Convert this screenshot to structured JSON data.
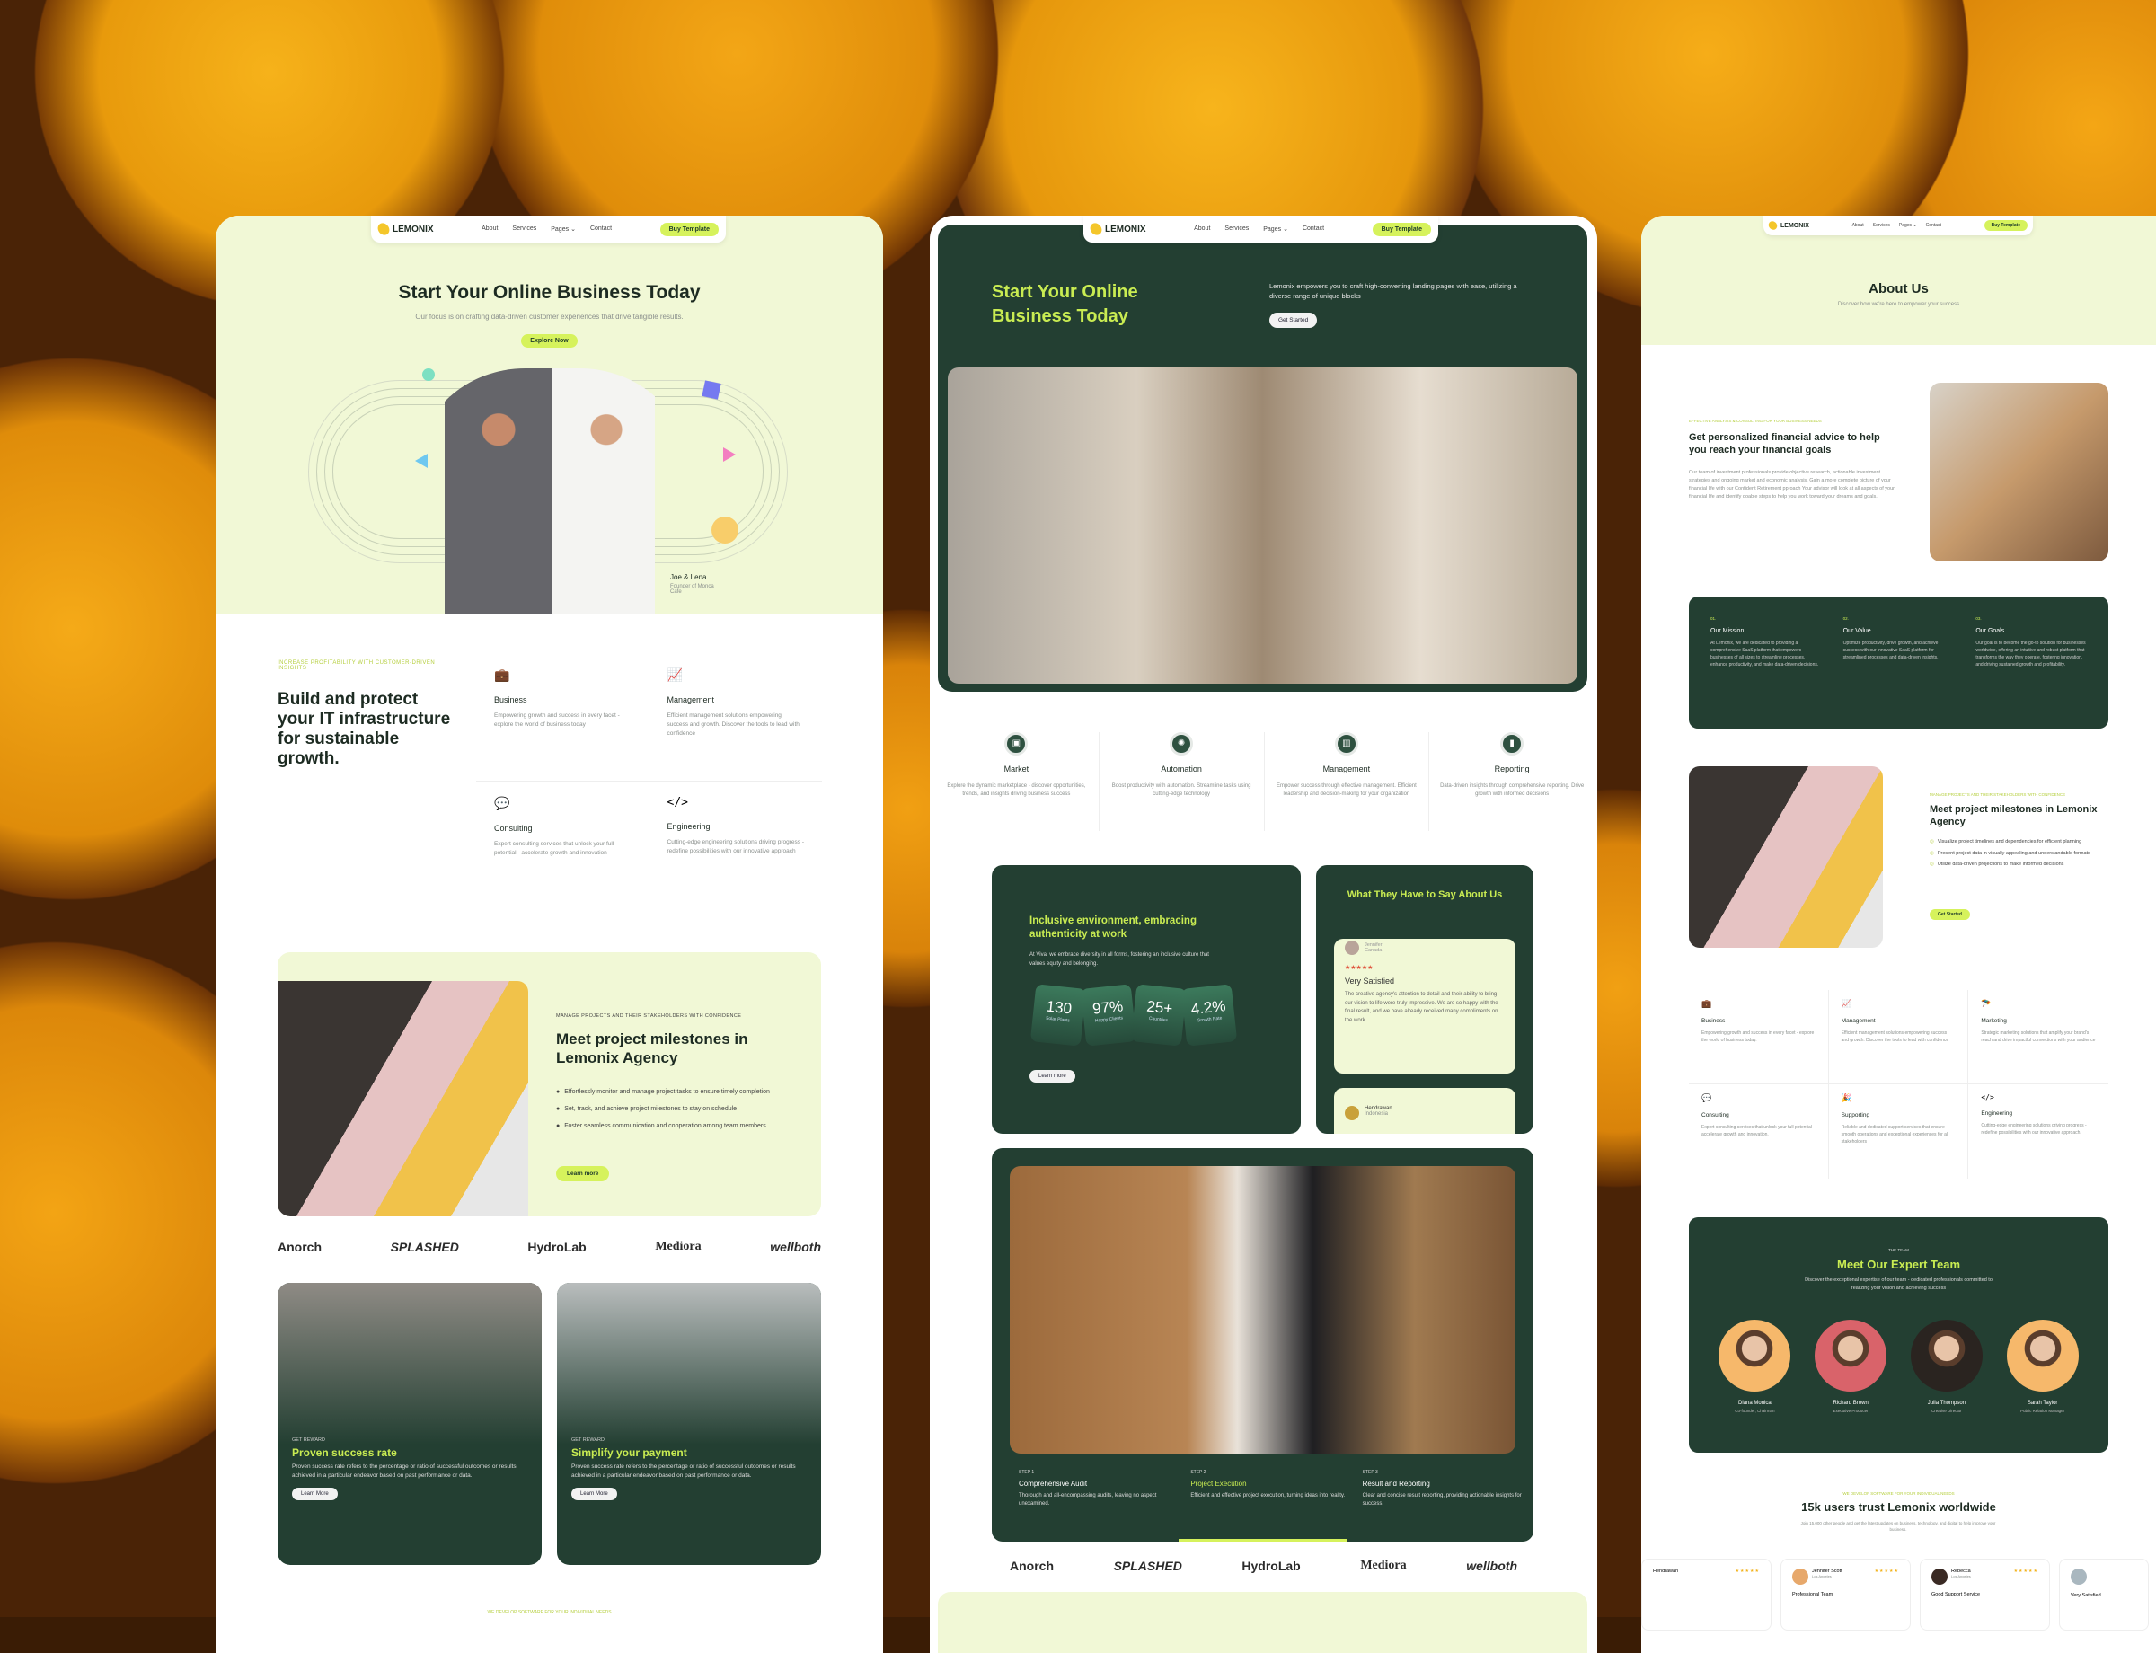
{
  "brand": "LEMONIX",
  "nav": {
    "items": [
      "About",
      "Services",
      "Pages",
      "Contact"
    ],
    "cta": "Buy Template"
  },
  "colors": {
    "accent_lime": "#d6f25c",
    "dark_green": "#233f32",
    "light_bg": "#f1f8d6",
    "text_dark": "#1d2b22"
  },
  "home1": {
    "hero": {
      "title": "Start Your Online Business Today",
      "subtitle": "Our focus is on crafting data-driven customer experiences that drive tangible results.",
      "cta": "Explore Now",
      "caption_name": "Joe & Lena",
      "caption_role": "Founder of Monca Cafe"
    },
    "services": {
      "eyebrow": "INCREASE PROFITABILITY WITH CUSTOMER-DRIVEN INSIGHTS",
      "title": "Build and protect your IT infrastructure for sustainable growth.",
      "items": [
        {
          "icon": "briefcase-icon",
          "title": "Business",
          "desc": "Empowering growth and success in every facet - explore the world of business today"
        },
        {
          "icon": "chart-line-icon",
          "title": "Management",
          "desc": "Efficient management solutions empowering success and growth. Discover the tools to lead with confidence"
        },
        {
          "icon": "chat-icon",
          "title": "Consulting",
          "desc": "Expert consulting services that unlock your full potential - accelerate growth and innovation"
        },
        {
          "icon": "code-icon",
          "title": "Engineering",
          "desc": "Cutting-edge engineering solutions driving progress - redefine possibilities with our innovative approach"
        }
      ]
    },
    "milestones": {
      "eyebrow": "MANAGE PROJECTS AND THEIR STAKEHOLDERS WITH CONFIDENCE",
      "title": "Meet project milestones in Lemonix Agency",
      "bullets": [
        "Effortlessly monitor and manage project tasks to ensure timely completion",
        "Set, track, and achieve project milestones to stay on schedule",
        "Foster seamless communication and cooperation among team members"
      ],
      "cta": "Learn more"
    },
    "logos": [
      "Anorch",
      "SPLASHED",
      "HydroLab",
      "Mediora",
      "wellboth"
    ],
    "rewards": [
      {
        "eyebrow": "GET REWARD",
        "title": "Proven success rate",
        "desc": "Proven success rate refers to the percentage or ratio of successful outcomes or results achieved in a particular endeavor based on past performance or data.",
        "cta": "Learn More"
      },
      {
        "eyebrow": "GET REWARD",
        "title": "Simplify your payment",
        "desc": "Proven success rate refers to the percentage or ratio of successful outcomes or results achieved in a particular endeavor based on past performance or data.",
        "cta": "Learn More"
      }
    ],
    "footer_eyebrow": "WE DEVELOP SOFTWARE FOR YOUR INDIVIDUAL NEEDS"
  },
  "home2": {
    "hero": {
      "title": "Start Your Online Business Today",
      "desc": "Lemonix empowers you to craft high-converting landing pages with ease, utilizing a diverse range of unique blocks",
      "cta": "Get Started"
    },
    "features": [
      {
        "icon": "briefcase-icon",
        "title": "Market",
        "desc": "Explore the dynamic marketplace - discover opportunities, trends, and insights driving business success"
      },
      {
        "icon": "brain-icon",
        "title": "Automation",
        "desc": "Boost productivity with automation. Streamline tasks using cutting-edge technology"
      },
      {
        "icon": "books-icon",
        "title": "Management",
        "desc": "Empower success through effective management. Efficient leadership and decision-making for your organization"
      },
      {
        "icon": "bar-chart-icon",
        "title": "Reporting",
        "desc": "Data-driven insights through comprehensive reporting. Drive growth with informed decisions"
      }
    ],
    "culture": {
      "title": "Inclusive environment, embracing authenticity at work",
      "desc": "At Viva, we embrace diversity in all forms, fostering an inclusive culture that values equity and belonging.",
      "stats": [
        {
          "value": "130",
          "label": "Solar Plants"
        },
        {
          "value": "97%",
          "label": "Happy Clients"
        },
        {
          "value": "25+",
          "label": "Countries"
        },
        {
          "value": "4.2%",
          "label": "Growth Rate"
        }
      ],
      "cta": "Learn more"
    },
    "testimonials": {
      "title": "What They Have to Say About Us",
      "items": [
        {
          "name": "Jennifer",
          "location": "Canada",
          "rating": 5,
          "title": "Very Satisfied",
          "text": "The creative agency's attention to detail and their ability to bring our vision to life were truly impressive. We are so happy with the final result, and we have already received many compliments on the work."
        },
        {
          "name": "Hendrawan",
          "location": "Indonesia"
        }
      ]
    },
    "steps": [
      {
        "label": "STEP 1",
        "title": "Comprehensive Audit",
        "desc": "Thorough and all-encompassing audits, leaving no aspect unexamined."
      },
      {
        "label": "STEP 2",
        "title": "Project Execution",
        "desc": "Efficient and effective project execution, turning ideas into reality."
      },
      {
        "label": "STEP 3",
        "title": "Result and Reporting",
        "desc": "Clear and concise result reporting, providing actionable insights for success."
      }
    ],
    "active_step": 2
  },
  "about": {
    "hero": {
      "title": "About Us",
      "subtitle": "Discover how we're here to empower your success"
    },
    "intro": {
      "eyebrow": "EFFECTIVE ANALYSIS & CONSULTING FOR YOUR BUSINESS NEEDS",
      "title": "Get personalized financial advice to help you reach your financial goals",
      "body": "Our team of investment professionals provide objective research, actionable investment strategies and ongoing market and economic analysis. Gain a more complete picture of your financial life with our Confident Retirement pproach Your advisor will look at all aspects of your financial life and identify doable steps to help you work toward your dreams and goals."
    },
    "values": [
      {
        "num": "01.",
        "title": "Our Mission",
        "desc": "At Lemonix, we are dedicated to providing a comprehensive SaaS platform that empowers businesses of all sizes to streamline processes, enhance productivity, and make data-driven decisions."
      },
      {
        "num": "02.",
        "title": "Our Value",
        "desc": "Optimize productivity, drive growth, and achieve success with our innovative SaaS platform for streamlined processes and data-driven insights."
      },
      {
        "num": "03.",
        "title": "Our Goals",
        "desc": "Our goal is to become the go-to solution for businesses worldwide, offering an intuitive and robust platform that transforms the way they operate, fostering innovation, and driving sustained growth and profitability."
      }
    ],
    "milestones": {
      "eyebrow": "MANAGE PROJECTS AND THEIR STAKEHOLDERS WITH CONFIDENCE",
      "title": "Meet project milestones in Lemonix Agency",
      "bullets": [
        "Visualize project timelines and dependencies for efficient planning",
        "Present project data in visually appealing and understandable formats",
        "Utilize data-driven projections to make informed decisions"
      ],
      "cta": "Get Started"
    },
    "services": [
      {
        "icon": "briefcase-icon",
        "title": "Business",
        "desc": "Empowering growth and success in every facet - explore the world of business today."
      },
      {
        "icon": "chart-line-icon",
        "title": "Management",
        "desc": "Efficient management solutions empowering success and growth. Discover the tools to lead with confidence"
      },
      {
        "icon": "parachute-icon",
        "title": "Marketing",
        "desc": "Strategic marketing solutions that amplify your brand's reach and drive impactful connections with your audience"
      },
      {
        "icon": "chat-icon",
        "title": "Consulting",
        "desc": "Expert consulting services that unlock your full potential - accelerate growth and innovation."
      },
      {
        "icon": "party-icon",
        "title": "Supporting",
        "desc": "Reliable and dedicated support services that ensure smooth operations and exceptional experiences for all stakeholders"
      },
      {
        "icon": "code-icon",
        "title": "Engineering",
        "desc": "Cutting-edge engineering solutions driving progress - redefine possibilities with our innovative approach."
      }
    ],
    "team": {
      "eyebrow": "THE TEAM",
      "title": "Meet Our Expert Team",
      "desc": "Discover the exceptional expertise of our team - dedicated professionals committed to realizing your vision and achieving success",
      "members": [
        {
          "name": "Diana Monica",
          "role": "Co-founder, Chairman",
          "bg": "#f6b86b"
        },
        {
          "name": "Richard Brown",
          "role": "Executive Producer",
          "bg": "#d9636a"
        },
        {
          "name": "Julia Thompson",
          "role": "Creative Director",
          "bg": "#2a2420"
        },
        {
          "name": "Sarah Taylor",
          "role": "Public Relation Manager",
          "bg": "#f6b86b"
        }
      ]
    },
    "trust": {
      "eyebrow": "WE DEVELOP SOFTWARE FOR YOUR INDIVIDUAL NEEDS",
      "title": "15k users trust Lemonix worldwide",
      "desc": "Join 15,000 other people and get the latest updates on business, technology, and digital to help improve your business.",
      "reviews": [
        {
          "name": "Hendrawan",
          "location": "",
          "rating": 5,
          "title": ""
        },
        {
          "name": "Jennifer Scott",
          "location": "Los Angeles",
          "rating": 5,
          "title": "Professional Team"
        },
        {
          "name": "Rebecca",
          "location": "Los Angeles",
          "rating": 5,
          "title": "Good Support Service"
        },
        {
          "name": "",
          "location": "",
          "rating": 0,
          "title": "Very Satisfied"
        }
      ]
    }
  }
}
